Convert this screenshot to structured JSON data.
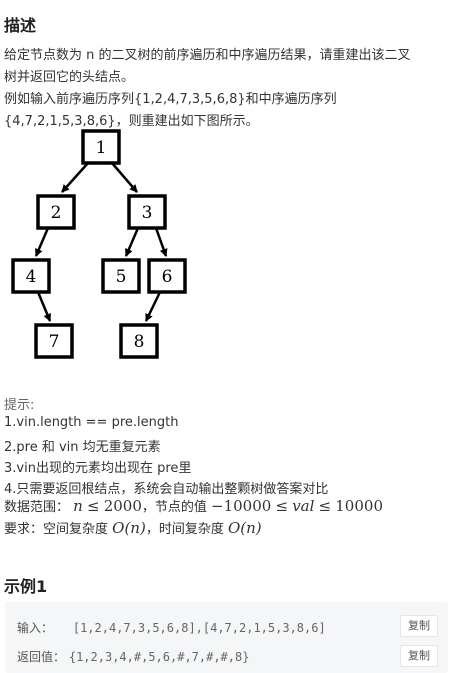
{
  "description": {
    "heading": "描述",
    "lines": [
      "给定节点数为 n 的二叉树的前序遍历和中序遍历结果，请重建出该二叉",
      "树并返回它的头结点。",
      "例如输入前序遍历序列{1,2,4,7,3,5,6,8}和中序遍历序列",
      "{4,7,2,1,5,3,8,6}，则重建出如下图所示。"
    ]
  },
  "tree": {
    "nodes": [
      "1",
      "2",
      "3",
      "4",
      "5",
      "6",
      "7",
      "8"
    ]
  },
  "hints": {
    "title": "提示:",
    "items": [
      "1.vin.length == pre.length",
      "2.pre 和 vin 均无重复元素",
      "3.vin出现的元素均出现在 pre里",
      "4.只需要返回根结点，系统会自动输出整颗树做答案对比"
    ]
  },
  "range": {
    "label": "数据范围：",
    "n": "n",
    "le": "≤",
    "n_max": "2000",
    "mid": "，节点的值",
    "val_min": "−10000",
    "val": "val",
    "val_max": "10000"
  },
  "requirement": {
    "label": "要求：空间复杂度",
    "space": "O(n)",
    "mid": "，时间复杂度",
    "time": "O(n)"
  },
  "example": {
    "heading": "示例1",
    "input_label": "输入：",
    "input_value": "[1,2,4,7,3,5,6,8],[4,7,2,1,5,3,8,6]",
    "output_label": "返回值：",
    "output_value": "{1,2,3,4,#,5,6,#,7,#,#,8}",
    "copy_label": "复制"
  }
}
